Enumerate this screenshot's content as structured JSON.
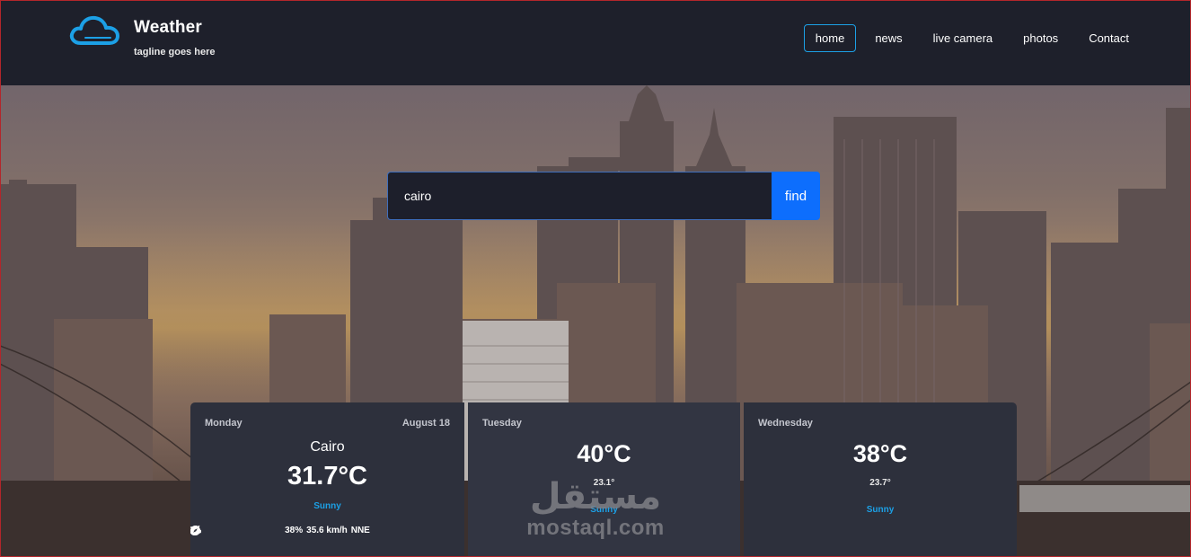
{
  "colors": {
    "accent": "#1ca0e6",
    "header_bg": "#1e202b",
    "card_bg": "#2d303c",
    "button_bg": "#0d6efd"
  },
  "brand": {
    "title": "Weather",
    "tagline": "tagline goes here",
    "icon": "cloud-icon"
  },
  "nav": {
    "items": [
      "home",
      "news",
      "live camera",
      "photos",
      "Contact"
    ],
    "active": "home"
  },
  "search": {
    "value": "cairo",
    "button": "find"
  },
  "forecast": [
    {
      "day": "Monday",
      "date": "August 18",
      "city": "Cairo",
      "temp": "31.7°C",
      "condition": "Sunny",
      "humidity": "38%",
      "wind": "35.6 km/h",
      "direction": "NNE"
    },
    {
      "day": "Tuesday",
      "max": "40°C",
      "min": "23.1°",
      "condition": "Sunny"
    },
    {
      "day": "Wednesday",
      "max": "38°C",
      "min": "23.7°",
      "condition": "Sunny"
    }
  ],
  "watermark": {
    "arabic": "مستقل",
    "latin": "mostaql.com"
  }
}
